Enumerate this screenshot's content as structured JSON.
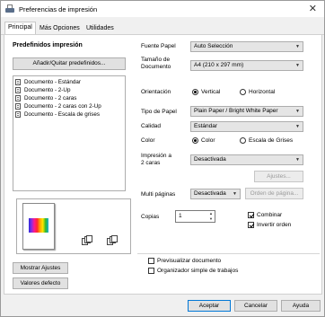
{
  "window": {
    "title": "Preferencias de impresión",
    "close_glyph": "✕"
  },
  "tabs": [
    "Principal",
    "Más Opciones",
    "Utilidades"
  ],
  "presets": {
    "heading": "Predefinidos impresión",
    "add_remove_button": "Añadir/Quitar predefinidos...",
    "items": [
      "Documento - Estándar",
      "Documento - 2-Up",
      "Documento - 2 caras",
      "Documento - 2 caras con 2-Up",
      "Documento - Escala de grises"
    ]
  },
  "settings": {
    "paper_source": {
      "label": "Fuente Papel",
      "value": "Auto Selección"
    },
    "doc_size": {
      "label_line1": "Tamaño de",
      "label_line2": "Documento",
      "value": "A4 (210 x 297 mm)"
    },
    "orientation": {
      "label": "Orientación",
      "options": [
        "Vertical",
        "Horizontal"
      ],
      "selected": "Vertical"
    },
    "paper_type": {
      "label": "Tipo de Papel",
      "value": "Plain Paper / Bright White Paper"
    },
    "quality": {
      "label": "Calidad",
      "value": "Estándar"
    },
    "color": {
      "label": "Color",
      "options": [
        "Color",
        "Escala de Grises"
      ],
      "selected": "Color"
    },
    "duplex": {
      "label_line1": "Impresión a",
      "label_line2": "2 caras",
      "value": "Desactivada",
      "settings_button": "Ajustes..."
    },
    "multipage": {
      "label": "Multi páginas",
      "value": "Desactivada",
      "order_button": "Orden de página..."
    },
    "copies": {
      "label": "Copias",
      "value": "1"
    },
    "collate": {
      "label": "Combinar",
      "checked": true
    },
    "reverse": {
      "label": "Invertir orden",
      "checked": true
    },
    "print_preview": {
      "label": "Previsualizar documento",
      "checked": false
    },
    "job_arranger": {
      "label": "Organizador simple de trabajos",
      "checked": false
    }
  },
  "buttons": {
    "show_settings": "Mostrar Ajustes",
    "defaults": "Valores defecto",
    "ok": "Aceptar",
    "cancel": "Cancelar",
    "help": "Ayuda"
  },
  "colors": {
    "accent": "#0078d7"
  }
}
